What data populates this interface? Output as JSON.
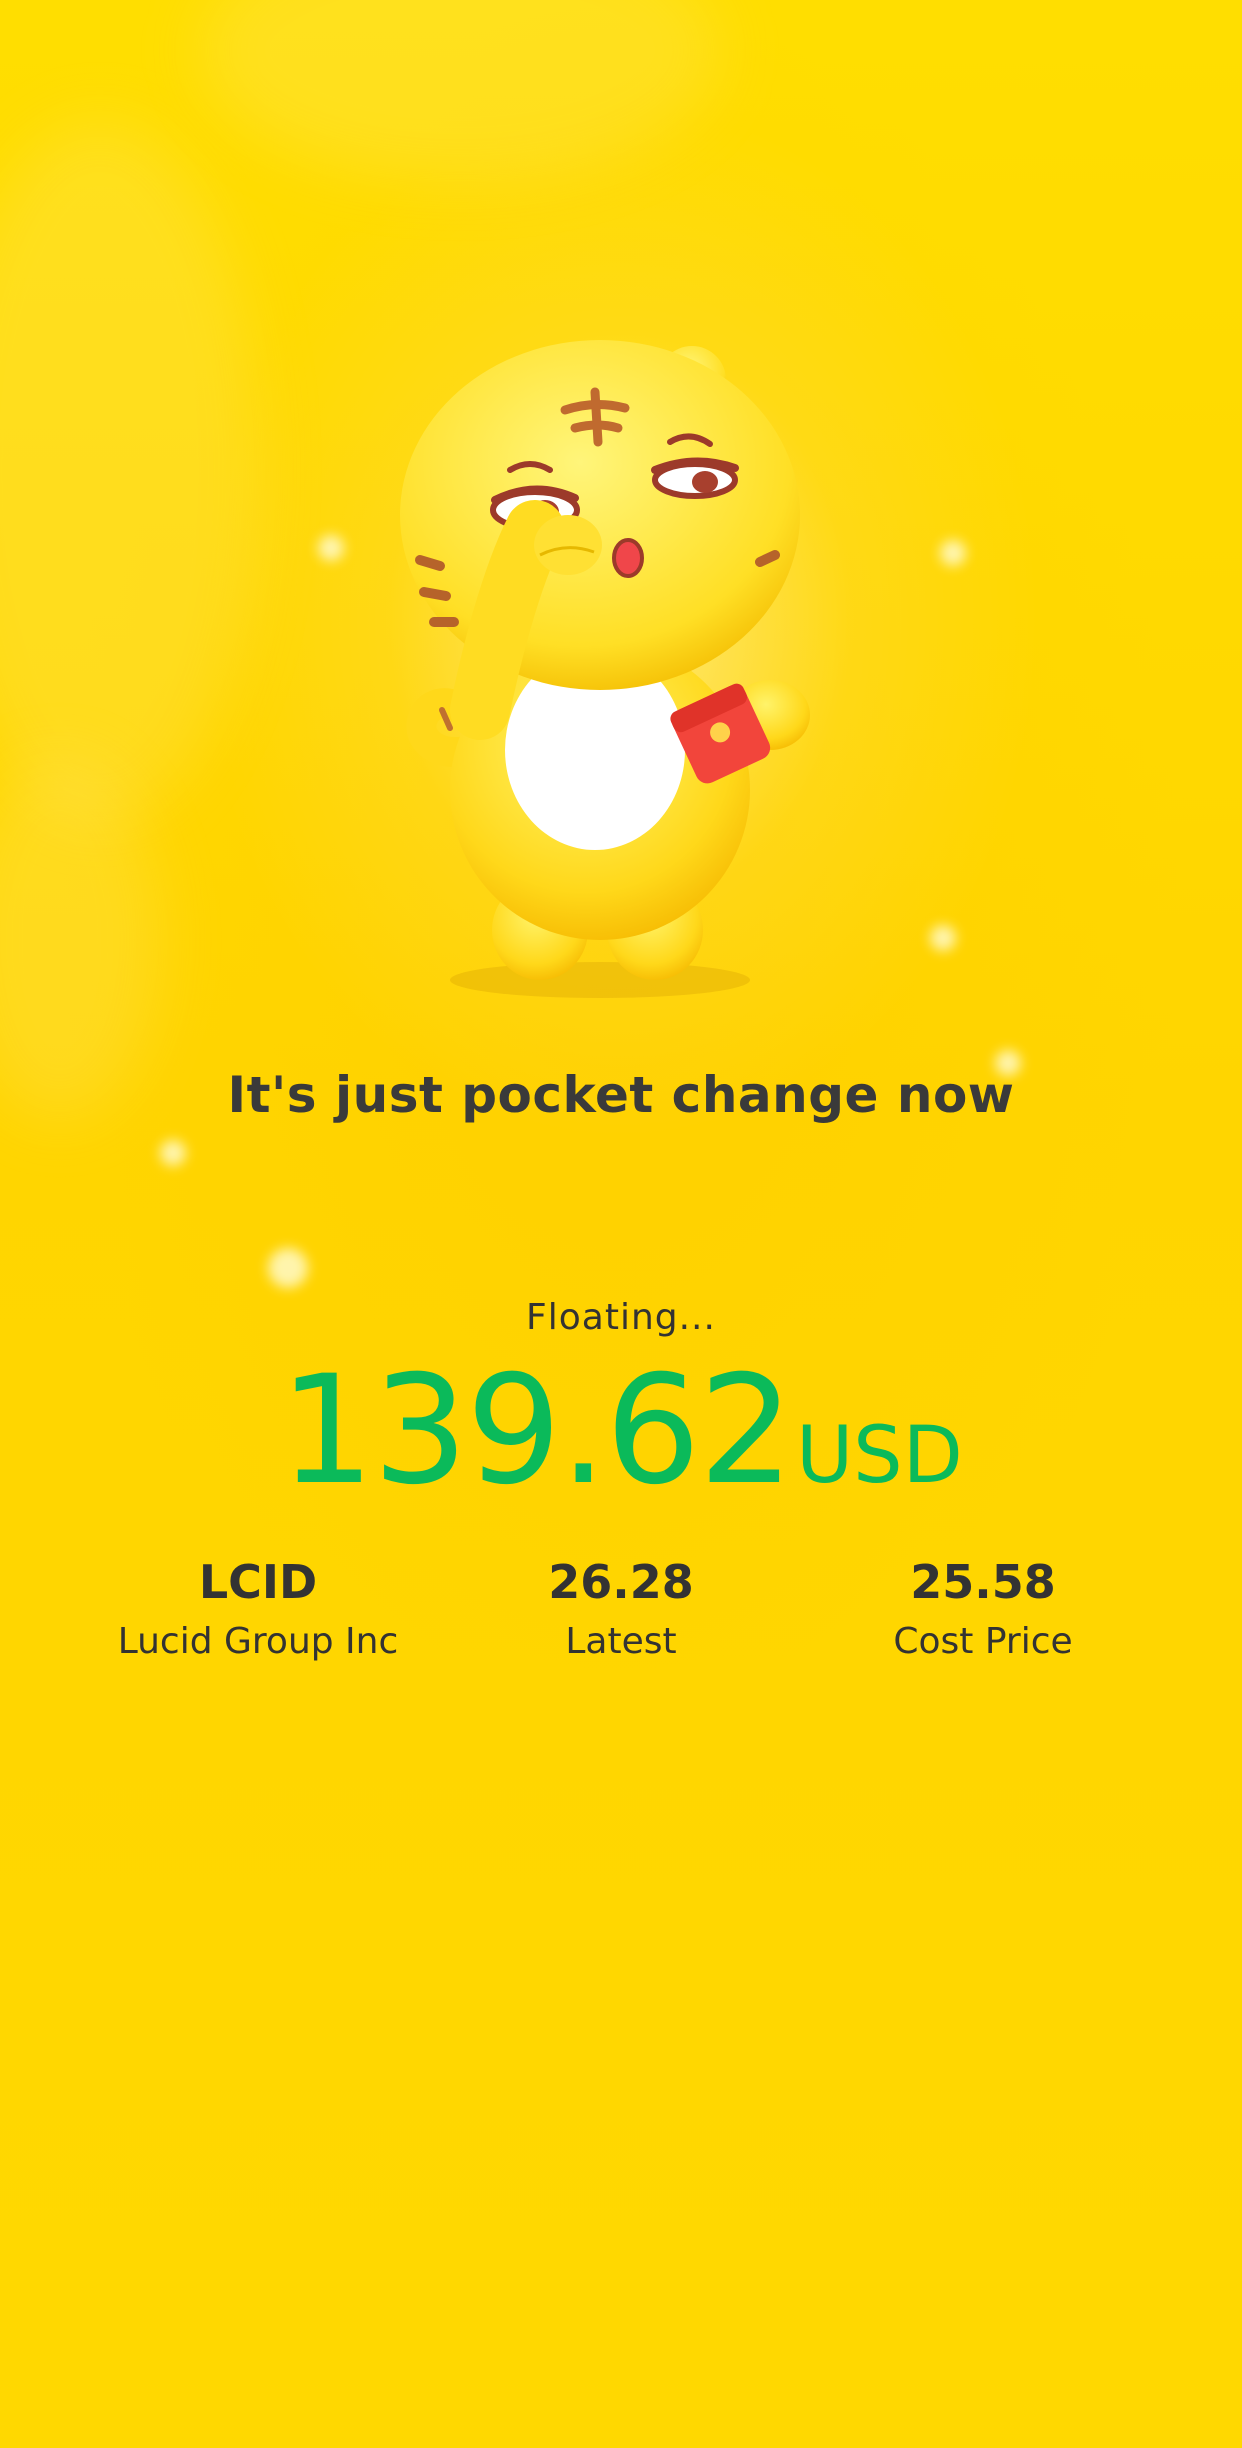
{
  "headline": "It's just pocket change now",
  "floating_label": "Floating...",
  "amount": {
    "value": "139.62",
    "currency": "USD"
  },
  "stats": [
    {
      "value": "LCID",
      "label": "Lucid Group Inc"
    },
    {
      "value": "26.28",
      "label": "Latest"
    },
    {
      "value": "25.58",
      "label": "Cost Price"
    }
  ],
  "colors": {
    "background": "#ffd800",
    "amount": "#0bba5a",
    "text": "#333333",
    "mascot_body": "#ffe33a",
    "red_envelope": "#f2453b"
  },
  "icons": {
    "mascot": "tiger-mascot-with-red-envelope"
  }
}
